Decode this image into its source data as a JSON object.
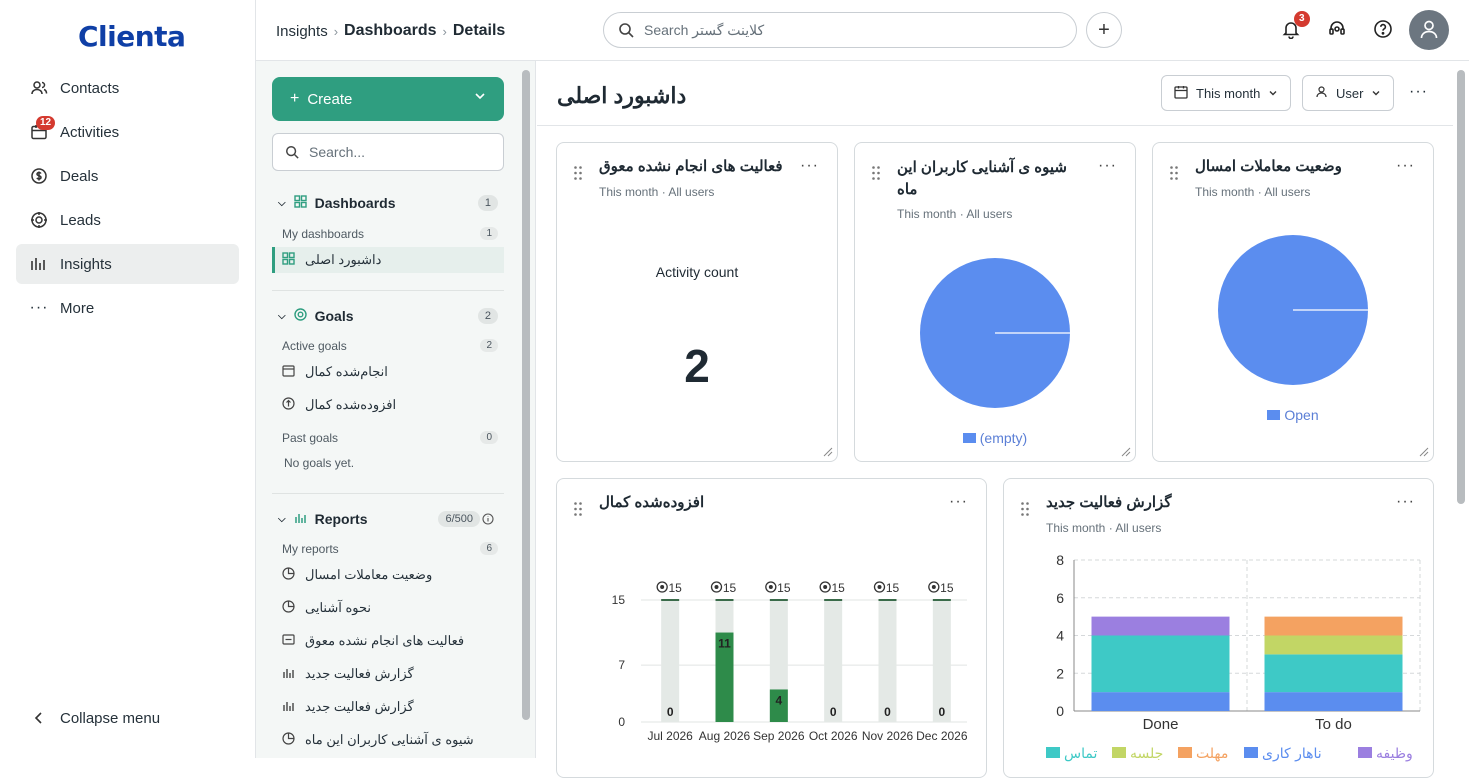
{
  "app": {
    "logo": "Clienta"
  },
  "nav": {
    "items": [
      {
        "label": "Contacts",
        "icon": "contacts-icon"
      },
      {
        "label": "Activities",
        "icon": "calendar-icon",
        "badge": "12"
      },
      {
        "label": "Deals",
        "icon": "dollar-icon"
      },
      {
        "label": "Leads",
        "icon": "target-icon"
      },
      {
        "label": "Insights",
        "icon": "bar-chart-icon",
        "active": true
      },
      {
        "label": "More",
        "icon": "more-icon"
      }
    ],
    "collapse": "Collapse menu"
  },
  "topbar": {
    "breadcrumb": [
      "Insights",
      "Dashboards",
      "Details"
    ],
    "search_placeholder": "Search کلاینت گستر",
    "notifications_badge": "3"
  },
  "panel": {
    "create": "Create",
    "search_placeholder": "Search...",
    "dashboards": {
      "title": "Dashboards",
      "count": "1",
      "sub": "My dashboards",
      "sub_count": "1",
      "items": [
        "داشبورد اصلی"
      ]
    },
    "goals": {
      "title": "Goals",
      "count": "2",
      "active": "Active goals",
      "active_count": "2",
      "items": [
        "انجام‌شده کمال",
        "افزوده‌شده کمال"
      ],
      "past": "Past goals",
      "past_count": "0",
      "empty": "No goals yet."
    },
    "reports": {
      "title": "Reports",
      "count": "6/500",
      "sub": "My reports",
      "sub_count": "6",
      "items": [
        "وضعیت معاملات امسال",
        "نحوه آشنایی",
        "فعالیت های انجام نشده معوق",
        "گزارش فعالیت جدید",
        "گزارش فعالیت جدید",
        "شیوه ی آشنایی کاربران این ماه"
      ]
    }
  },
  "main": {
    "title": "داشبورد اصلی",
    "period": "This month",
    "user": "User"
  },
  "cards": {
    "overdue": {
      "title": "فعالیت های انجام نشده معوق",
      "sub": "This month · All users",
      "label": "Activity count",
      "value": "2"
    },
    "source": {
      "title": "شیوه ی آشنایی کاربران این ماه",
      "sub": "This month · All users",
      "legend": "(empty)"
    },
    "deals": {
      "title": "وضعیت معاملات امسال",
      "sub": "This month · All users",
      "legend": "Open"
    },
    "added": {
      "title": "افزوده‌شده کمال"
    },
    "report": {
      "title": "گزارش فعالیت جدید",
      "sub": "This month · All users"
    }
  },
  "colors": {
    "accent": "#2f9e80",
    "pie": "#5b8def",
    "bar_done": "#2e8b4a",
    "bar_track": "#e4e9e6"
  },
  "chart_data": [
    {
      "type": "pie",
      "title": "شیوه ی آشنایی کاربران این ماه",
      "categories": [
        "(empty)"
      ],
      "values": [
        1
      ]
    },
    {
      "type": "pie",
      "title": "وضعیت معاملات امسال",
      "categories": [
        "Open"
      ],
      "values": [
        1
      ]
    },
    {
      "type": "bar",
      "title": "افزوده‌شده کمال",
      "categories": [
        "Jul 2026",
        "Aug 2026",
        "Sep 2026",
        "Oct 2026",
        "Nov 2026",
        "Dec 2026"
      ],
      "values": [
        0,
        11,
        4,
        0,
        0,
        0
      ],
      "goal": [
        15,
        15,
        15,
        15,
        15,
        15
      ],
      "yticks": [
        0,
        7,
        15
      ],
      "ylim": [
        0,
        15
      ]
    },
    {
      "type": "bar",
      "stacked": true,
      "title": "گزارش فعالیت جدید",
      "categories": [
        "Done",
        "To do"
      ],
      "series": [
        {
          "name": "ناهار کاری",
          "color": "#5b8def",
          "values": [
            1,
            1
          ]
        },
        {
          "name": "تماس",
          "color": "#3ec9c6",
          "values": [
            3,
            2
          ]
        },
        {
          "name": "جلسه",
          "color": "#c2d665",
          "values": [
            0,
            1
          ]
        },
        {
          "name": "مهلت",
          "color": "#f4a261",
          "values": [
            0,
            1
          ]
        },
        {
          "name": "وظیفه",
          "color": "#9b7fe0",
          "values": [
            1,
            0
          ]
        }
      ],
      "yticks": [
        0,
        2,
        4,
        6,
        8
      ],
      "ylim": [
        0,
        8
      ],
      "legend_order": [
        "تماس",
        "جلسه",
        "مهلت",
        "ناهار کاری",
        "وظیفه"
      ]
    }
  ]
}
